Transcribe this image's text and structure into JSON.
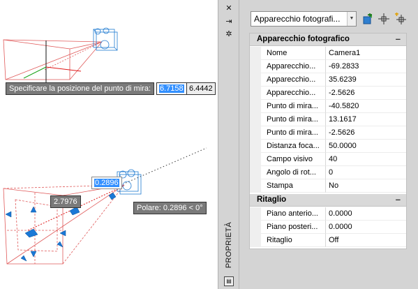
{
  "drawing": {
    "prompt_label": "Specificare la posizione del punto di mira:",
    "input_x_value": "6.7158",
    "input_y_value": "6.4442",
    "lens_input_value": "0.2896",
    "distance_value": "2.7976",
    "polar_readout": "Polare: 0.2896 < 0°"
  },
  "palette": {
    "vertical_title": "PROPRIETÀ",
    "object_selector_value": "Apparecchio  fotografi...",
    "tool_icons": [
      "select-objects-icon",
      "quick-select-icon",
      "toggle-pickadd-icon"
    ],
    "sections": [
      {
        "title": "Apparecchio fotografico",
        "collapse_symbol": "–",
        "rows": [
          {
            "key": "Nome",
            "value": "Camera1"
          },
          {
            "key": "Apparecchio...",
            "value": "-69.2833"
          },
          {
            "key": "Apparecchio...",
            "value": "35.6239"
          },
          {
            "key": "Apparecchio...",
            "value": "-2.5626"
          },
          {
            "key": "Punto di mira...",
            "value": "-40.5820"
          },
          {
            "key": "Punto di mira...",
            "value": "13.1617"
          },
          {
            "key": "Punto di mira...",
            "value": "-2.5626"
          },
          {
            "key": "Distanza foca...",
            "value": "50.0000"
          },
          {
            "key": "Campo visivo",
            "value": "40"
          },
          {
            "key": "Angolo di rot...",
            "value": "0"
          },
          {
            "key": "Stampa",
            "value": "No"
          }
        ]
      },
      {
        "title": "Ritaglio",
        "collapse_symbol": "–",
        "rows": [
          {
            "key": "Piano anterio...",
            "value": "0.0000"
          },
          {
            "key": "Piano posteri...",
            "value": "0.0000"
          },
          {
            "key": "Ritaglio",
            "value": "Off"
          }
        ]
      }
    ]
  },
  "colors": {
    "frustum": "#e05a5a",
    "camera": "#1f7ad1",
    "grip": "#1a78d6",
    "selection": "#3390ff"
  }
}
